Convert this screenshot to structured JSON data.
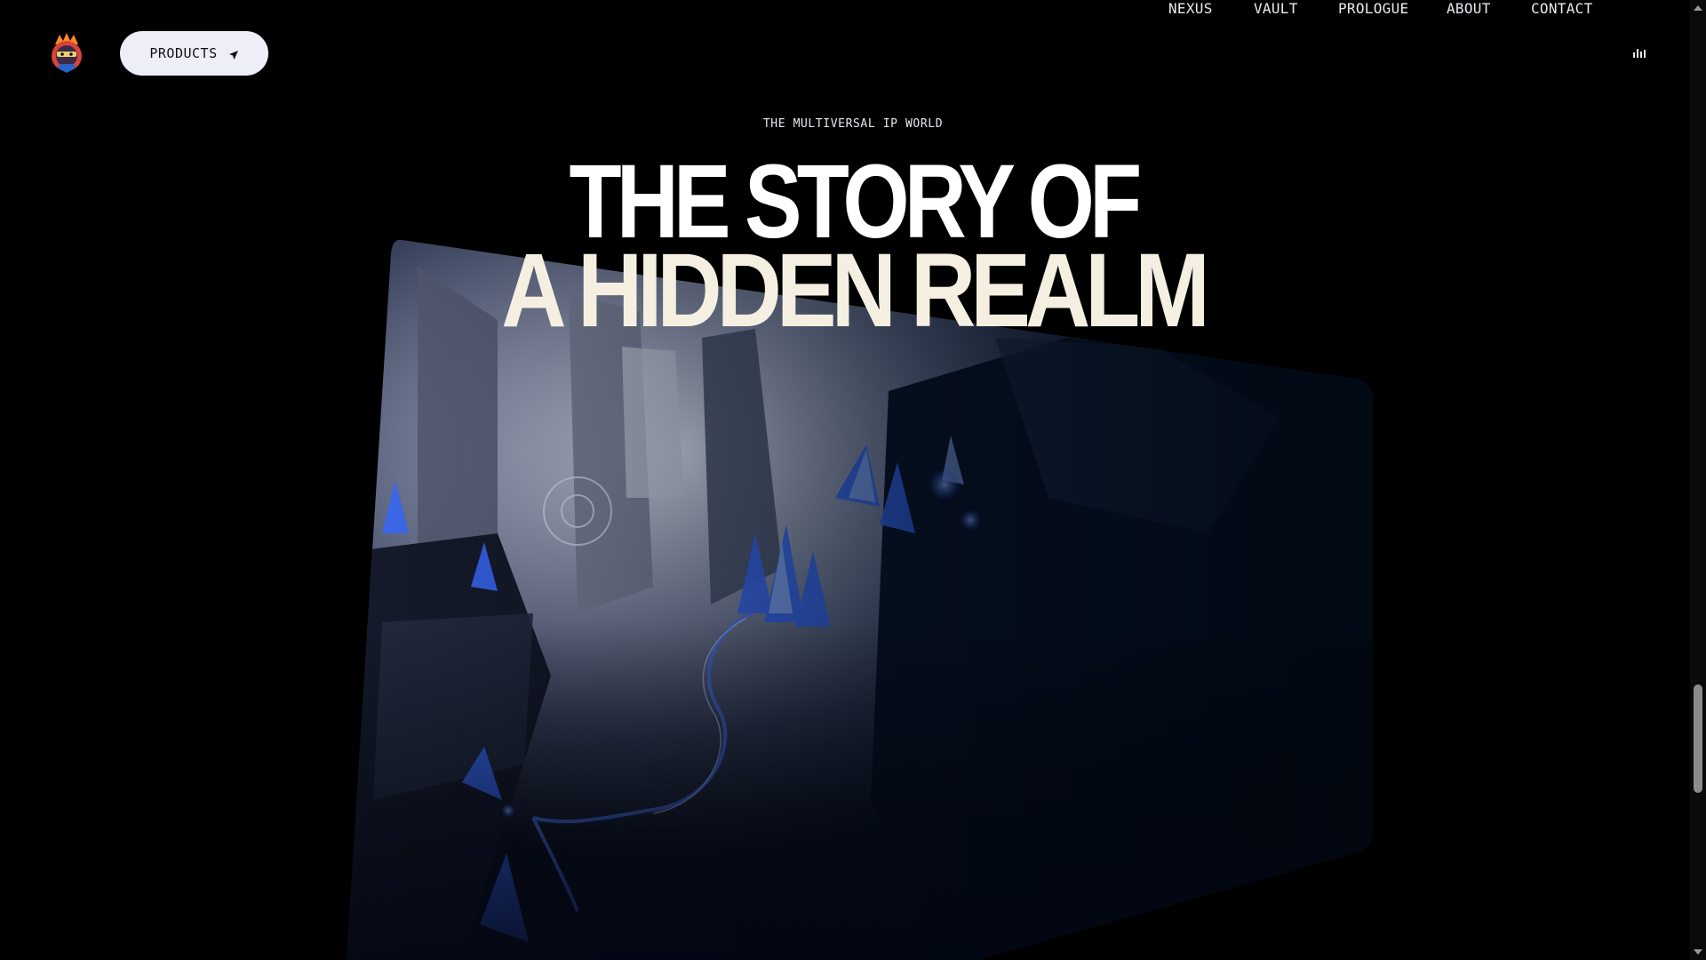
{
  "header": {
    "logo_icon": "ninja-mascot-logo-icon",
    "products_label": "PRODUCTS",
    "products_icon": "paper-plane-arrow-icon",
    "nav": [
      {
        "label": "NEXUS"
      },
      {
        "label": "VAULT"
      },
      {
        "label": "PROLOGUE"
      },
      {
        "label": "ABOUT"
      },
      {
        "label": "CONTACT"
      }
    ],
    "audio_icon": "audio-bars-icon"
  },
  "hero": {
    "eyebrow": "THE MULTIVERSAL IP WORLD",
    "title_line_1": "THE STORY OF",
    "title_line_2": "A HIDDEN REALM",
    "image_icon": "crystal-cave-scene-image"
  },
  "colors": {
    "background": "#000000",
    "button_bg": "#eeeef9",
    "text": "#e9e9f2",
    "crystal_blue": "#2a5cff"
  },
  "scrollbar": {
    "position_fraction": 0.72
  }
}
